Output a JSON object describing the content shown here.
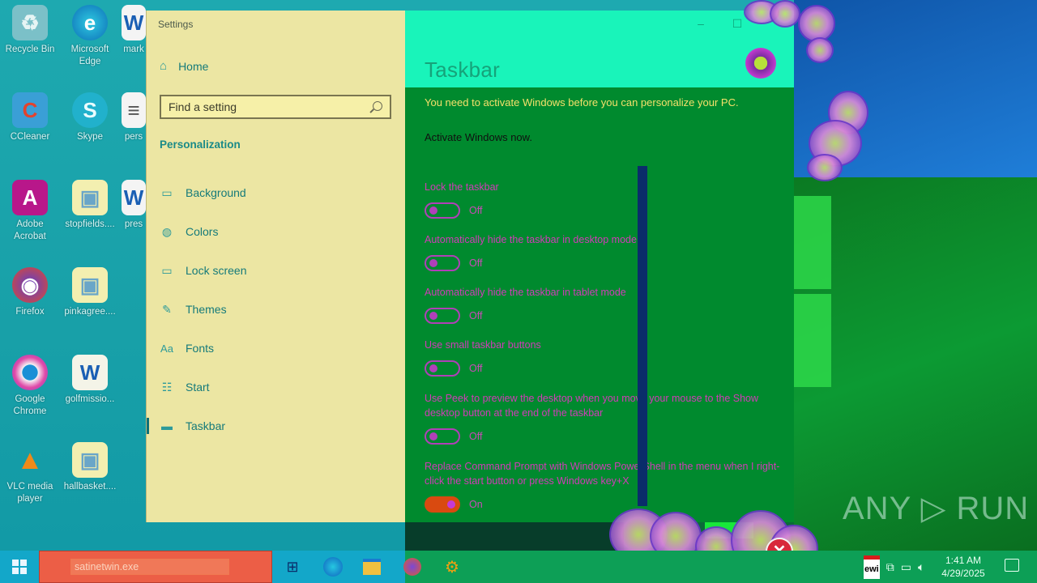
{
  "desktop": {
    "icons": [
      {
        "label": "Recycle Bin",
        "glyph": "♻"
      },
      {
        "label": "Microsoft Edge",
        "glyph": "e"
      },
      {
        "label": "mark",
        "glyph": "W"
      },
      {
        "label": "CCleaner",
        "glyph": "C"
      },
      {
        "label": "Skype",
        "glyph": "S"
      },
      {
        "label": "pers",
        "glyph": "≡"
      },
      {
        "label": "Adobe Acrobat",
        "glyph": "A"
      },
      {
        "label": "stopfields....",
        "glyph": "▣"
      },
      {
        "label": "pres",
        "glyph": "W"
      },
      {
        "label": "Firefox",
        "glyph": "◉"
      },
      {
        "label": "pinkagree....",
        "glyph": "▣"
      },
      {
        "label": "Google Chrome",
        "glyph": "◎"
      },
      {
        "label": "golfmissio...",
        "glyph": "W"
      },
      {
        "label": "VLC media player",
        "glyph": "▲"
      },
      {
        "label": "hallbasket....",
        "glyph": "▣"
      }
    ]
  },
  "settings": {
    "window_title": "Settings",
    "home_label": "Home",
    "search_placeholder": "Find a setting",
    "section_title": "Personalization",
    "nav": [
      {
        "label": "Background",
        "icon": "image-icon"
      },
      {
        "label": "Colors",
        "icon": "palette-icon"
      },
      {
        "label": "Lock screen",
        "icon": "lock-screen-icon"
      },
      {
        "label": "Themes",
        "icon": "themes-icon"
      },
      {
        "label": "Fonts",
        "icon": "fonts-icon"
      },
      {
        "label": "Start",
        "icon": "start-icon"
      },
      {
        "label": "Taskbar",
        "icon": "taskbar-icon"
      }
    ],
    "active_nav": "Taskbar",
    "page_title": "Taskbar",
    "activation_message": "You need to activate Windows before you can personalize your PC.",
    "activation_link": "Activate Windows now.",
    "settings": [
      {
        "label": "Lock the taskbar",
        "state": "Off",
        "on": false
      },
      {
        "label": "Automatically hide the taskbar in desktop mode",
        "state": "Off",
        "on": false
      },
      {
        "label": "Automatically hide the taskbar in tablet mode",
        "state": "Off",
        "on": false
      },
      {
        "label": "Use small taskbar buttons",
        "state": "Off",
        "on": false
      },
      {
        "label": "Use Peek to preview the desktop when you move your mouse to the Show desktop button at the end of the taskbar",
        "state": "Off",
        "on": false
      },
      {
        "label": "Replace Command Prompt with Windows PowerShell in the menu when I right-click the start button or press Windows key+X",
        "state": "On",
        "on": true
      }
    ]
  },
  "taskbar": {
    "search_value": "satinetwin.exe",
    "tray_app_label": "ewi",
    "clock_time": "1:41 AM",
    "clock_date": "4/29/2025"
  },
  "watermark": "ANY ▷ RUN"
}
